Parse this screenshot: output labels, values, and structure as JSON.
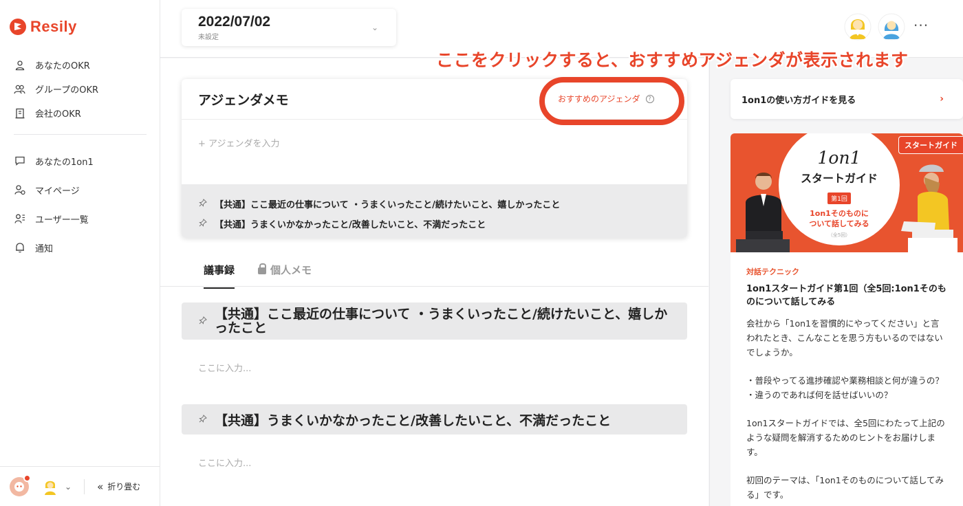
{
  "brand": {
    "name": "Resily",
    "accent": "#e8452a"
  },
  "sidebar": {
    "primary": [
      {
        "label": "あなたのOKR",
        "icon": "person-icon"
      },
      {
        "label": "グループのOKR",
        "icon": "group-icon"
      },
      {
        "label": "会社のOKR",
        "icon": "building-icon"
      }
    ],
    "secondary": [
      {
        "label": "あなたの1on1",
        "icon": "chat-icon"
      },
      {
        "label": "マイページ",
        "icon": "profile-icon"
      },
      {
        "label": "ユーザー一覧",
        "icon": "user-list-icon"
      },
      {
        "label": "通知",
        "icon": "bell-icon"
      }
    ],
    "collapse_label": "折り畳む"
  },
  "header": {
    "date": "2022/07/02",
    "date_sub": "未設定",
    "more": "···"
  },
  "annotation": {
    "text": "ここをクリックすると、おすすめアジェンダが表示されます"
  },
  "agenda": {
    "title": "アジェンダメモ",
    "recommend_label": "おすすめのアジェンダ",
    "input_placeholder": "+ アジェンダを入力",
    "items": [
      "【共通】ここ最近の仕事について ・うまくいったこと/続けたいこと、嬉しかったこと",
      "【共通】うまくいかなかったこと/改善したいこと、不満だったこと"
    ]
  },
  "tabs": {
    "minutes": "議事録",
    "private_memo": "個人メモ"
  },
  "sections": [
    {
      "title": "【共通】ここ最近の仕事について ・うまくいったこと/続けたいこと、嬉しかったこと",
      "placeholder": "ここに入力..."
    },
    {
      "title": "【共通】うまくいかなかったこと/改善したいこと、不満だったこと",
      "placeholder": "ここに入力..."
    }
  ],
  "right_panel": {
    "guide_link": "1on1の使い方ガイドを見る",
    "hero": {
      "tag": "スタートガイド",
      "title": "1on1",
      "subtitle": "スタートガイド",
      "badge": "第1回",
      "desc_line1": "1on1そのものに",
      "desc_line2": "ついて話してみる",
      "count": "（全5回）"
    },
    "article": {
      "category": "対話テクニック",
      "title": "1on1スタートガイド第1回（全5回:1on1そのものについて話してみる",
      "p1": "会社から「1on1を習慣的にやってください」と言われたとき、こんなことを思う方もいるのではないでしょうか。",
      "p2": "・普段やってる進捗確認や業務相談と何が違うの？\n・違うのであれば何を話せばいいの？",
      "p3": "1on1スタートガイドでは、全5回にわたって上記のような疑問を解消するためのヒントをお届けします。",
      "p4": "初回のテーマは、「1on1そのものについて話してみる」です。"
    }
  }
}
